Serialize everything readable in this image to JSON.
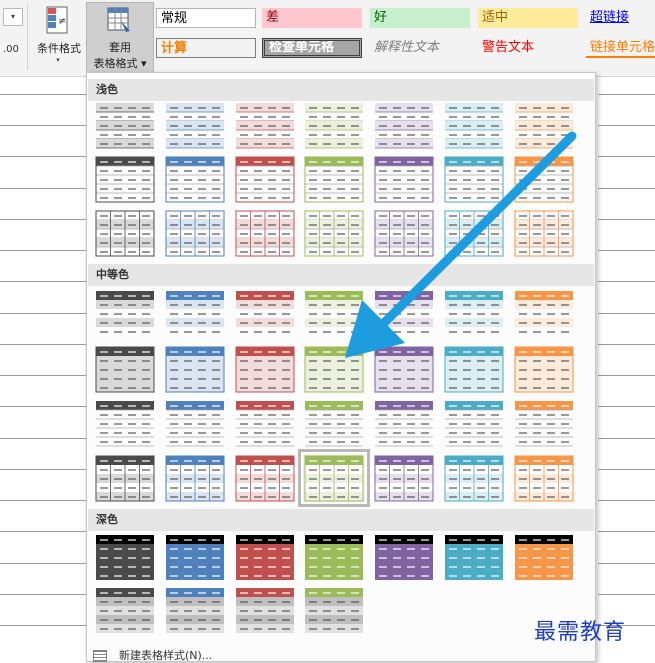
{
  "ribbon": {
    "number_format_hint": ".00",
    "conditional_format_label": "条件格式",
    "format_as_table_line1": "套用",
    "format_as_table_line2": "表格格式 ▾",
    "cell_styles": {
      "normal": "常规",
      "bad": "差",
      "good": "好",
      "neutral": "适中",
      "hyperlink": "超链接",
      "calculation": "计算",
      "check_cell": "检查单元格",
      "explanatory": "解释性文本",
      "warning": "警告文本",
      "linked_cell": "链接单元格"
    }
  },
  "gallery": {
    "sections": {
      "light": "浅色",
      "medium": "中等色",
      "dark": "深色"
    },
    "new_table_style": "新建表格样式(N)...",
    "colors": [
      "#4a4a4a",
      "#4f81bd",
      "#c0504d",
      "#9bbb59",
      "#8064a2",
      "#4bacc6",
      "#f79646"
    ],
    "tints": [
      "#d9d9d9",
      "#dbe5f1",
      "#f2dcdb",
      "#ebf1de",
      "#e5e0ec",
      "#dbeef3",
      "#fdeada"
    ],
    "light_rows": 3,
    "medium_rows": 4,
    "dark_rows": 2,
    "dark_row2_count": 4
  },
  "watermark": "最需教育"
}
